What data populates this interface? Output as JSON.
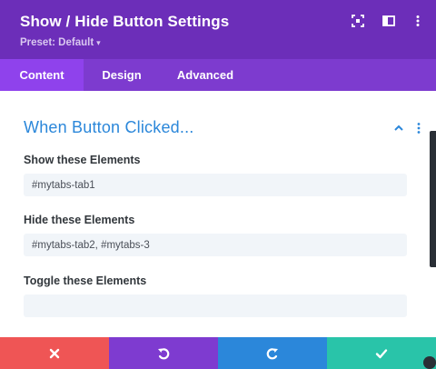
{
  "header": {
    "title": "Show / Hide Button Settings",
    "preset_label": "Preset: Default",
    "preset_caret": "▾",
    "background": "#6c2eb9"
  },
  "tabs": [
    {
      "label": "Content",
      "active": true
    },
    {
      "label": "Design",
      "active": false
    },
    {
      "label": "Advanced",
      "active": false
    }
  ],
  "section": {
    "title": "When Button Clicked...",
    "accent_color": "#2b87da",
    "fields": [
      {
        "label": "Show these Elements",
        "value": "#mytabs-tab1",
        "placeholder": ""
      },
      {
        "label": "Hide these Elements",
        "value": "#mytabs-tab2, #mytabs-3",
        "placeholder": ""
      },
      {
        "label": "Toggle these Elements",
        "value": "",
        "placeholder": ""
      }
    ]
  },
  "footer": {
    "buttons": [
      {
        "name": "discard",
        "icon": "close-icon",
        "color": "#ef5555"
      },
      {
        "name": "undo",
        "icon": "undo-icon",
        "color": "#7e3bd0"
      },
      {
        "name": "redo",
        "icon": "redo-icon",
        "color": "#2b87da"
      },
      {
        "name": "save",
        "icon": "checkmark-icon",
        "color": "#29c4a9"
      }
    ]
  }
}
